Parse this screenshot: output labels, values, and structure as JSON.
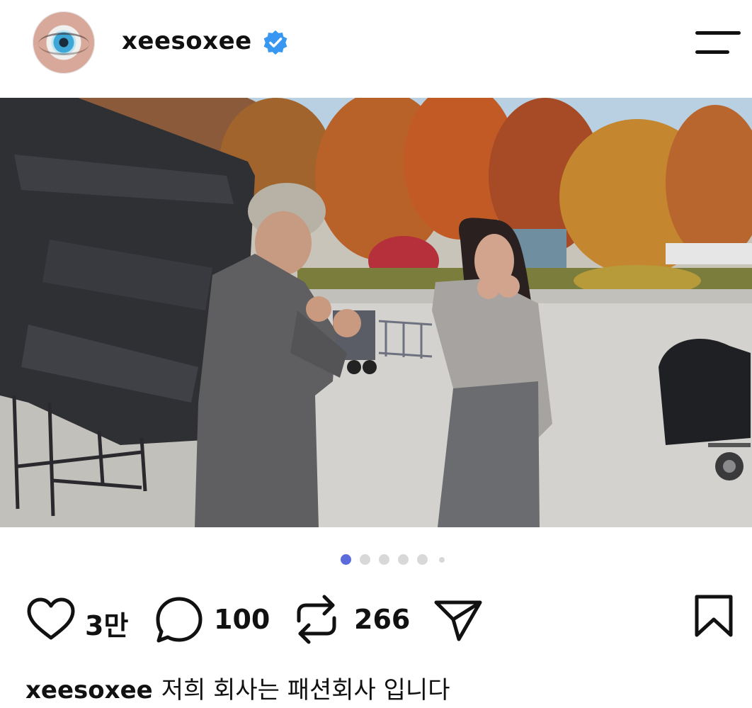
{
  "post": {
    "username": "xeesoxee",
    "verified": true,
    "carousel": {
      "total": 6,
      "active_index": 0
    },
    "actions": {
      "likes": "3만",
      "comments": "100",
      "reposts": "266"
    },
    "caption": {
      "username": "xeesoxee",
      "text": "저희 회사는 패션회사 입니다"
    }
  },
  "icons": {
    "verified": "verified-badge-icon",
    "menu": "menu-icon",
    "like": "heart-icon",
    "comment": "comment-bubble-icon",
    "repost": "repost-icon",
    "share": "send-icon",
    "save": "bookmark-icon"
  },
  "colors": {
    "verified": "#3897f0",
    "carousel_active": "#5b6bdc",
    "carousel_inactive": "#d8d8d8"
  }
}
